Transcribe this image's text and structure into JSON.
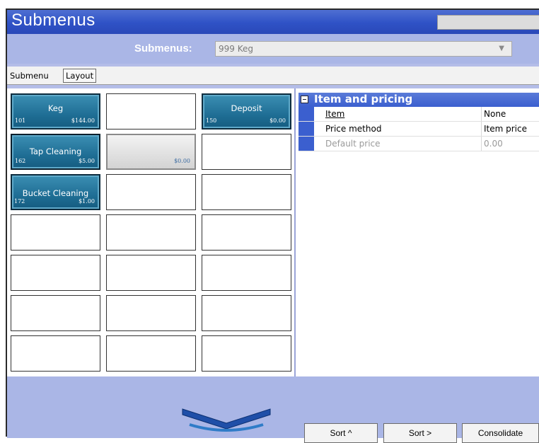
{
  "window": {
    "title": "Submenus"
  },
  "filter": {
    "label": "Submenus:",
    "selected": "999 Keg"
  },
  "tabs": [
    {
      "label": "Submenu"
    },
    {
      "label": "Layout"
    }
  ],
  "grid": {
    "buttons": [
      {
        "name": "Keg",
        "number": "101",
        "price": "$144.00"
      },
      {
        "name": "Deposit",
        "number": "150",
        "price": "$0.00"
      },
      {
        "name": "Tap Cleaning",
        "number": "162",
        "price": "$5.00"
      },
      {
        "name": "",
        "number": "",
        "price": "$0.00"
      },
      {
        "name": "Bucket Cleaning",
        "number": "172",
        "price": "$1.00"
      }
    ]
  },
  "properties": {
    "section_title": "Item and pricing",
    "rows": [
      {
        "name": "Item",
        "value": "None"
      },
      {
        "name": "Price method",
        "value": "Item price"
      },
      {
        "name": "Default price",
        "value": "0.00"
      }
    ]
  },
  "bottom": {
    "sort_up": "Sort ^",
    "sort_right": "Sort >",
    "consolidate": "Consolidate"
  },
  "colors": {
    "title_bar": "#2f52c6",
    "background": "#b4bde8",
    "button": "#1f6e95"
  }
}
